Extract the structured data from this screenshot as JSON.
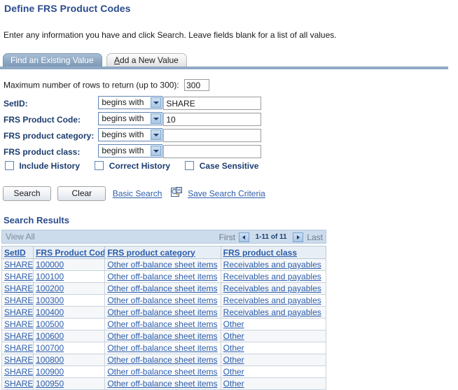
{
  "page": {
    "title": "Define FRS Product Codes",
    "instruction": "Enter any information you have and click Search. Leave fields blank for a list of all values."
  },
  "tabs": [
    {
      "label": "Find an Existing Value",
      "active": true
    },
    {
      "label_prefix": "",
      "accel": "A",
      "label_rest": "dd a New Value",
      "active": false
    }
  ],
  "search_form": {
    "max_rows_label": "Maximum number of rows to return (up to 300):",
    "max_rows_value": "300",
    "fields": [
      {
        "label": "SetID:",
        "operator": "begins with",
        "value": "SHARE"
      },
      {
        "label": "FRS Product Code:",
        "operator": "begins with",
        "value": "10"
      },
      {
        "label": "FRS product category:",
        "operator": "begins with",
        "value": ""
      },
      {
        "label": "FRS product class:",
        "operator": "begins with",
        "value": ""
      }
    ],
    "checkboxes": [
      {
        "label": "Include History",
        "checked": false
      },
      {
        "label": "Correct History",
        "checked": false
      },
      {
        "label": "Case Sensitive",
        "checked": false
      }
    ],
    "search_button": "Search",
    "clear_button": "Clear",
    "basic_search_link": "Basic Search",
    "save_search_link": "Save Search Criteria",
    "save_icon_name": "save-search-icon"
  },
  "results": {
    "heading": "Search Results",
    "view_all_label": "View All",
    "pager": {
      "first_label": "First",
      "prev_icon": "left-arrow-icon",
      "range_label": "1-11 of 11",
      "next_icon": "right-arrow-icon",
      "last_label": "Last"
    },
    "columns": [
      "SetID",
      "FRS Product Code",
      "FRS product category",
      "FRS product class"
    ],
    "rows": [
      [
        "SHARE",
        "100000",
        "Other off-balance sheet items",
        "Receivables and payables"
      ],
      [
        "SHARE",
        "100100",
        "Other off-balance sheet items",
        "Receivables and payables"
      ],
      [
        "SHARE",
        "100200",
        "Other off-balance sheet items",
        "Receivables and payables"
      ],
      [
        "SHARE",
        "100300",
        "Other off-balance sheet items",
        "Receivables and payables"
      ],
      [
        "SHARE",
        "100400",
        "Other off-balance sheet items",
        "Receivables and payables"
      ],
      [
        "SHARE",
        "100500",
        "Other off-balance sheet items",
        "Other"
      ],
      [
        "SHARE",
        "100600",
        "Other off-balance sheet items",
        "Other"
      ],
      [
        "SHARE",
        "100700",
        "Other off-balance sheet items",
        "Other"
      ],
      [
        "SHARE",
        "100800",
        "Other off-balance sheet items",
        "Other"
      ],
      [
        "SHARE",
        "100900",
        "Other off-balance sheet items",
        "Other"
      ],
      [
        "SHARE",
        "100950",
        "Other off-balance sheet items",
        "Other"
      ]
    ]
  },
  "colors": {
    "title_blue": "#2a4b8d",
    "label_blue": "#1c3d6e",
    "link_blue": "#2a5caa",
    "tab_active_bg": "#8fa9c4",
    "grid_header_bg": "#e8eef5",
    "viewall_bar_bg": "#ccdcec"
  }
}
